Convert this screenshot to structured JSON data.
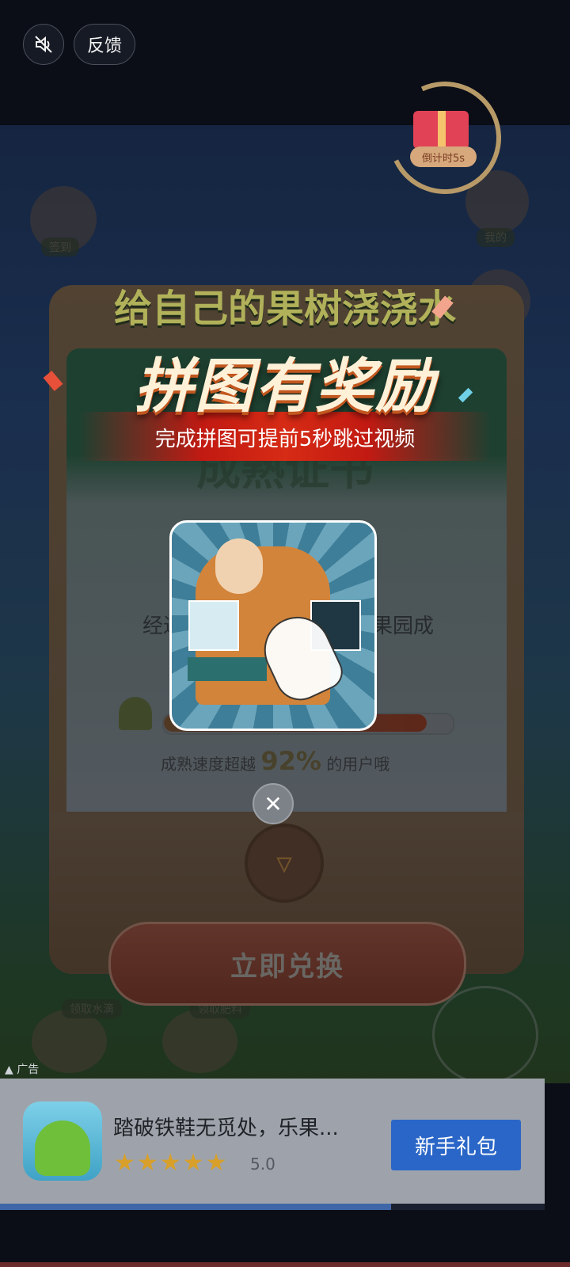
{
  "top_bar": {
    "mute_icon": "mute-icon",
    "feedback_label": "反馈"
  },
  "countdown": {
    "label": "倒计时5s",
    "icon": "gift-icon"
  },
  "game": {
    "headline_small": "给自己的果树浇浇水",
    "headline_big": "拼图有奖励",
    "subheading": "完成拼图可提前5秒跳过视频",
    "card_title": "成熟证书",
    "card_line": "经过",
    "card_line_end": "果园成",
    "percent_prefix": "成熟速度超越",
    "percent_value": "92%",
    "percent_suffix": "的用户哦",
    "redeem_button": "立即兑换",
    "bg_tag_left": "签到",
    "bg_tag_right": "我的",
    "bg_tag_water": "领取水滴",
    "bg_tag_fertilizer": "领取肥料",
    "progress": 0.92
  },
  "puzzle": {
    "close_icon": "close-icon",
    "close_glyph": "✕"
  },
  "ad": {
    "label": "广告",
    "app_title": "踏破铁鞋无觅处，乐果...",
    "stars": "★★★★★",
    "rating": "5.0",
    "cta_button": "新手礼包"
  },
  "colors": {
    "cta_blue": "#2a66c7",
    "star_gold": "#d8a02a",
    "ribbon_red": "#d62b15"
  }
}
